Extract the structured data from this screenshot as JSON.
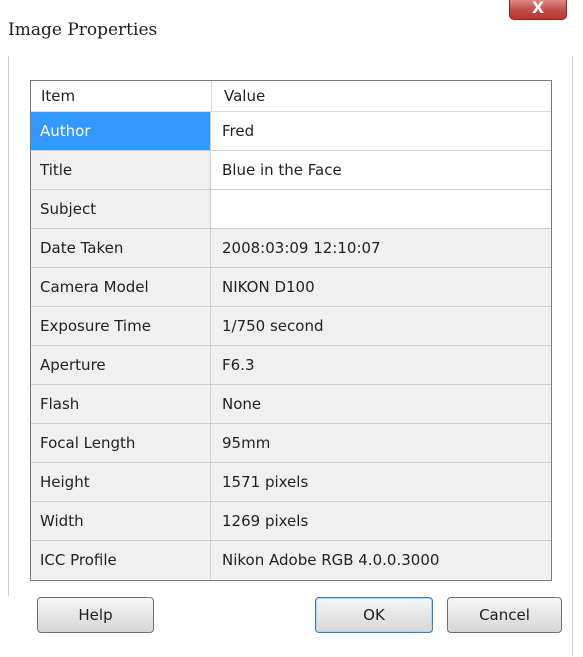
{
  "window": {
    "title": "Image Properties",
    "close_label": "X"
  },
  "grid": {
    "headers": {
      "item": "Item",
      "value": "Value"
    },
    "rows": [
      {
        "item": "Author",
        "value": "Fred"
      },
      {
        "item": "Title",
        "value": "Blue in the Face"
      },
      {
        "item": "Subject",
        "value": ""
      },
      {
        "item": "Date Taken",
        "value": "2008:03:09 12:10:07"
      },
      {
        "item": "Camera Model",
        "value": "NIKON D100"
      },
      {
        "item": "Exposure Time",
        "value": "1/750 second"
      },
      {
        "item": "Aperture",
        "value": "F6.3"
      },
      {
        "item": "Flash",
        "value": "None"
      },
      {
        "item": "Focal Length",
        "value": "95mm"
      },
      {
        "item": "Height",
        "value": "1571 pixels"
      },
      {
        "item": "Width",
        "value": "1269 pixels"
      },
      {
        "item": "ICC Profile",
        "value": "Nikon Adobe RGB 4.0.0.3000"
      }
    ]
  },
  "buttons": {
    "help": "Help",
    "ok": "OK",
    "cancel": "Cancel"
  },
  "colors": {
    "selection": "#3399ff",
    "close_button": "#c44a42"
  }
}
